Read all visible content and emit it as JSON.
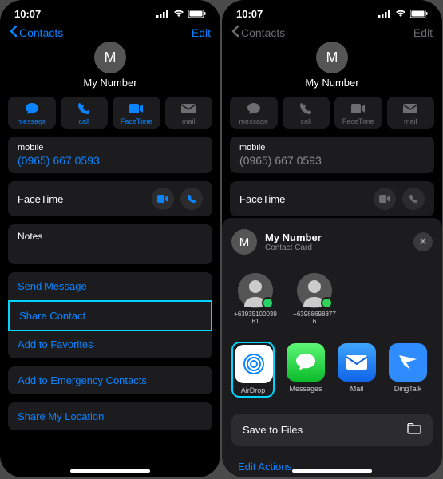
{
  "status": {
    "time": "10:07"
  },
  "nav": {
    "back": "Contacts",
    "edit": "Edit"
  },
  "contact": {
    "initial": "M",
    "name": "My Number",
    "phone_label": "mobile",
    "phone": "(0965) 667 0593",
    "facetime": "FaceTime",
    "notes": "Notes"
  },
  "actions": {
    "message": "message",
    "call": "call",
    "facetime": "FaceTime",
    "mail": "mail"
  },
  "menu": {
    "send_message": "Send Message",
    "share_contact": "Share Contact",
    "add_favorites": "Add to Favorites",
    "add_emergency": "Add to Emergency Contacts",
    "share_location": "Share My Location"
  },
  "sheet": {
    "title": "My Number",
    "subtitle": "Contact Card",
    "contacts": [
      {
        "label": "+63935100039 61"
      },
      {
        "label": "+63968698877 6"
      }
    ],
    "apps": {
      "airdrop": "AirDrop",
      "messages": "Messages",
      "mail": "Mail",
      "dingtalk": "DingTalk"
    },
    "save_files": "Save to Files",
    "edit_actions": "Edit Actions..."
  }
}
